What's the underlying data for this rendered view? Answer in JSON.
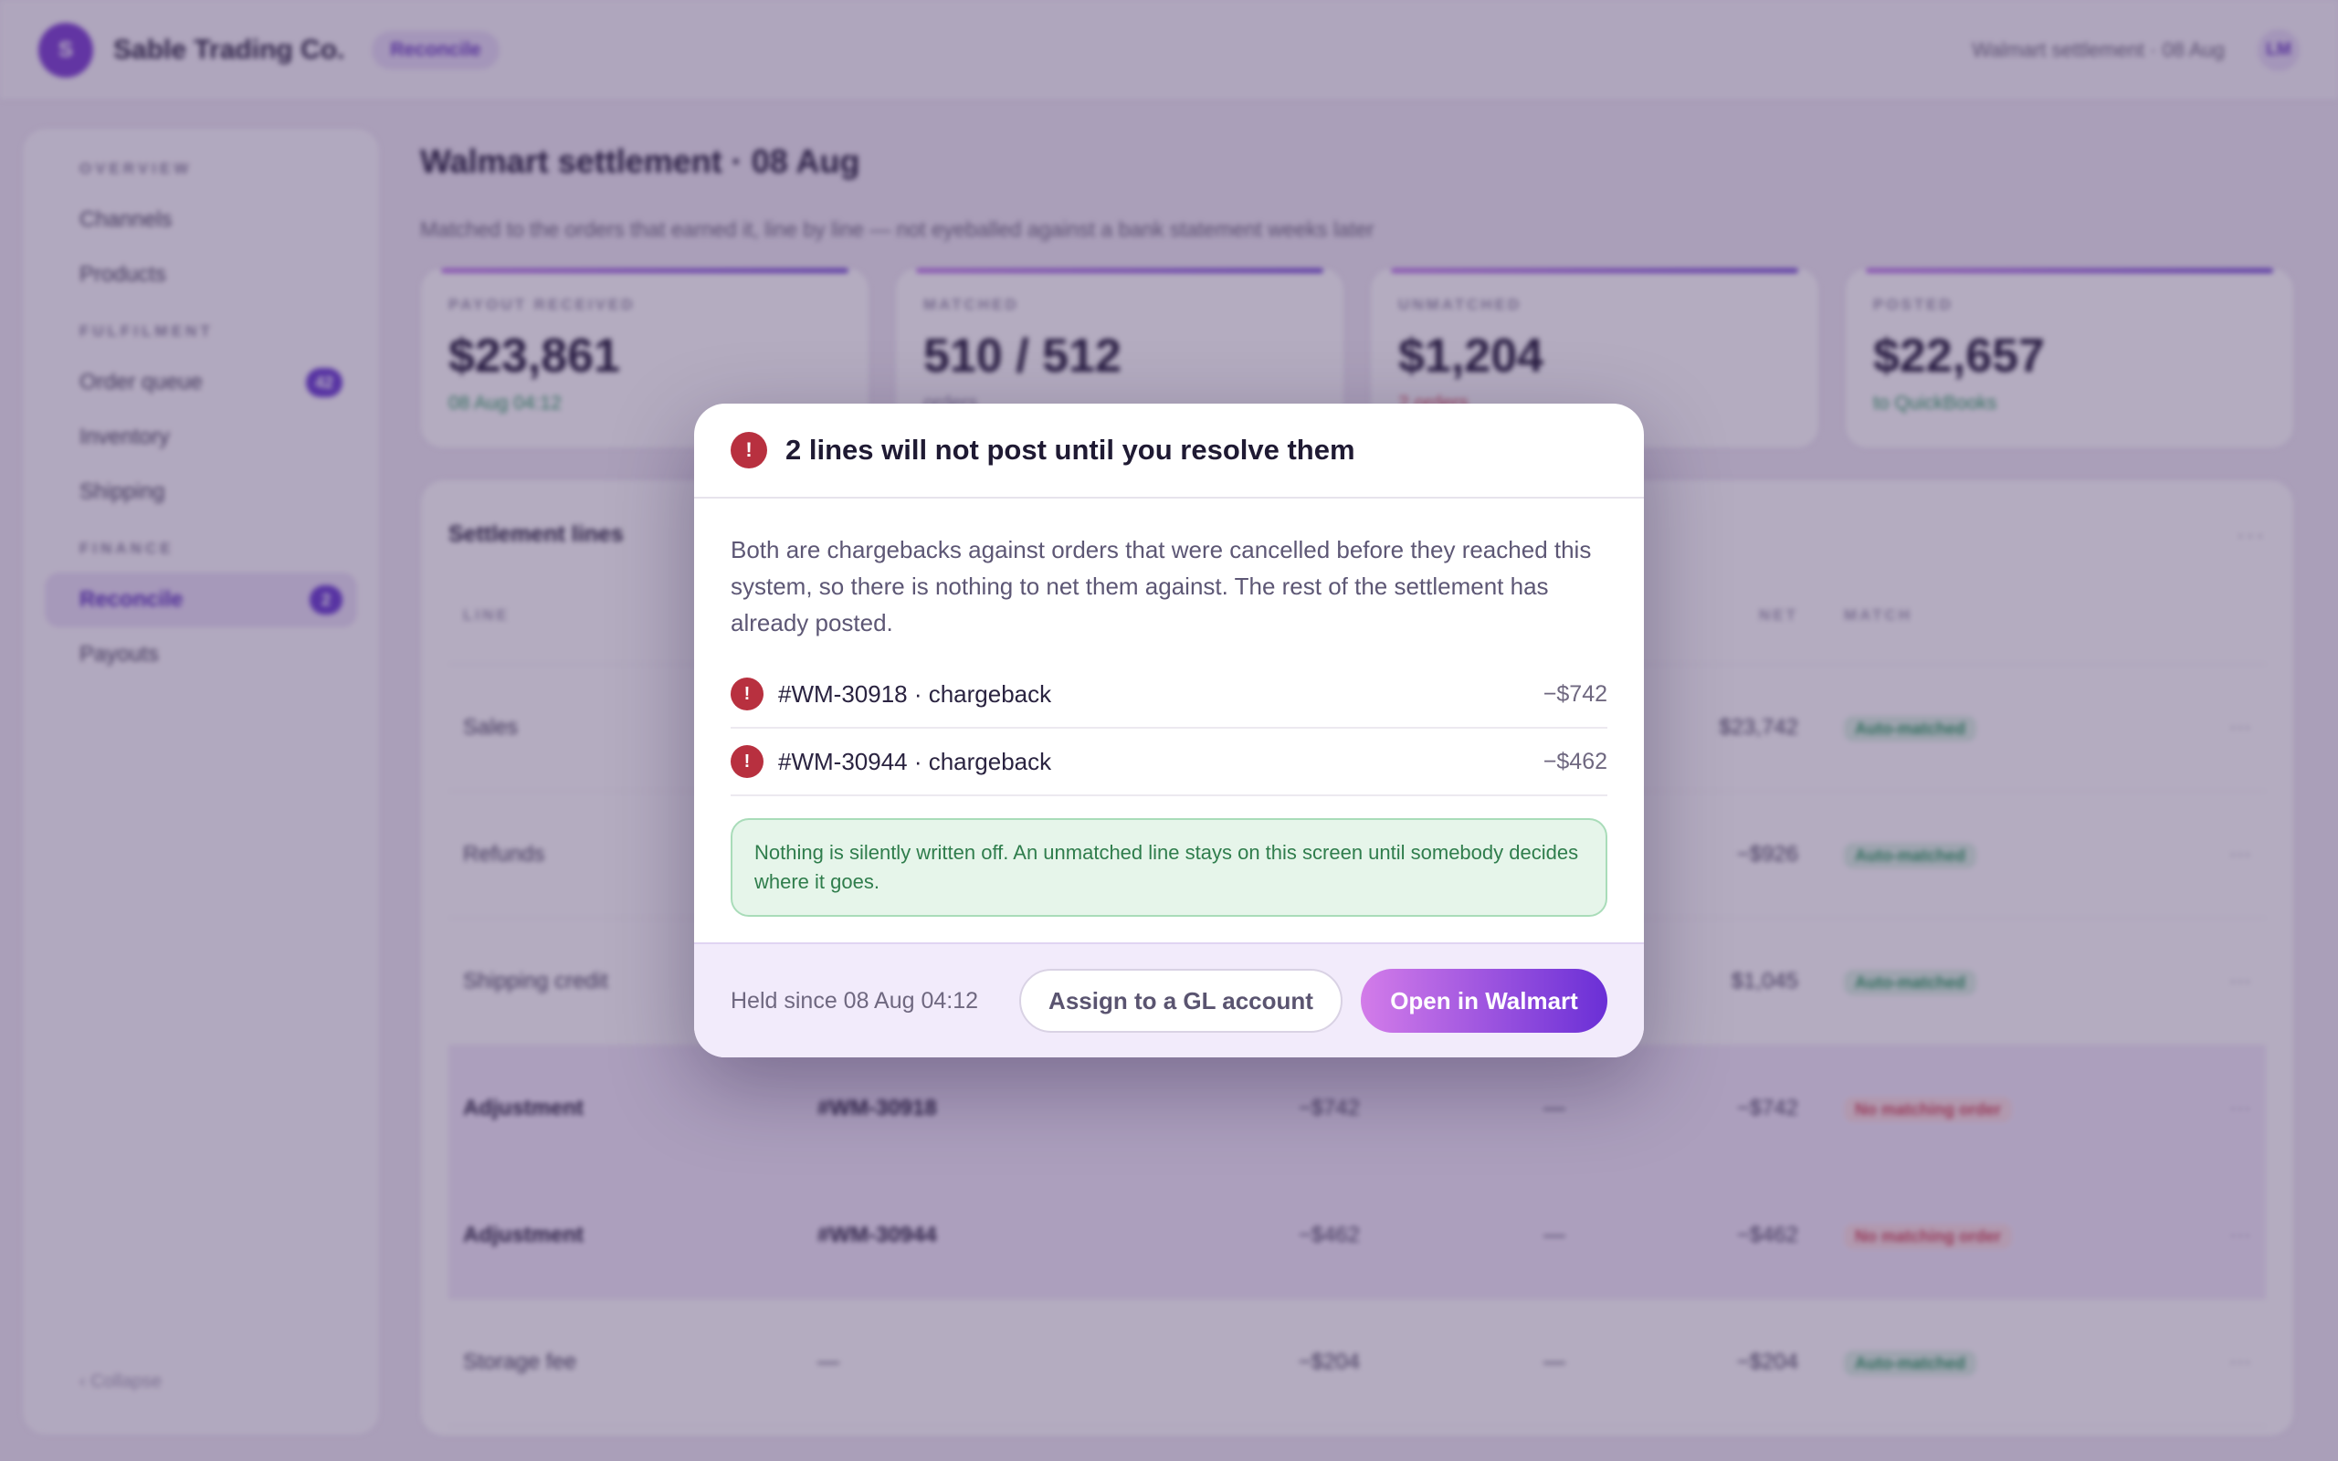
{
  "topbar": {
    "logo_letter": "S",
    "brand": "Sable Trading Co.",
    "section_tag": "Reconcile",
    "breadcrumb": "Walmart settlement · 08 Aug",
    "user_initials": "LM"
  },
  "sidebar": {
    "groups": [
      {
        "label": "OVERVIEW",
        "items": [
          {
            "label": "Channels"
          },
          {
            "label": "Products"
          }
        ]
      },
      {
        "label": "FULFILMENT",
        "items": [
          {
            "label": "Order queue",
            "badge": "42"
          },
          {
            "label": "Inventory"
          },
          {
            "label": "Shipping"
          }
        ]
      },
      {
        "label": "FINANCE",
        "items": [
          {
            "label": "Reconcile",
            "badge": "2",
            "active": true
          },
          {
            "label": "Payouts"
          }
        ]
      }
    ],
    "collapse_label": "‹ Collapse"
  },
  "main": {
    "title": "Walmart settlement · 08 Aug",
    "subtitle": "Matched to the orders that earned it, line by line — not eyeballed against a bank statement weeks later"
  },
  "stats": [
    {
      "label": "PAYOUT RECEIVED",
      "value": "$23,861",
      "note": "08 Aug 04:12"
    },
    {
      "label": "MATCHED",
      "value": "510 / 512",
      "note": "orders"
    },
    {
      "label": "UNMATCHED",
      "value": "$1,204",
      "note": "2 orders"
    },
    {
      "label": "POSTED",
      "value": "$22,657",
      "note": "to QuickBooks"
    }
  ],
  "settlement": {
    "title": "Settlement lines",
    "columns": {
      "line": "LINE",
      "net": "NET",
      "match": "MATCH"
    },
    "rows": [
      {
        "line": "Sales",
        "order": "",
        "amount": "",
        "fee": "",
        "net": "$23,742",
        "match": "Auto-matched"
      },
      {
        "line": "Refunds",
        "order": "",
        "amount": "",
        "fee": "",
        "net": "−$926",
        "match": "Auto-matched"
      },
      {
        "line": "Shipping credit",
        "order": "",
        "amount": "",
        "fee": "",
        "net": "$1,045",
        "match": "Auto-matched"
      },
      {
        "line": "Adjustment",
        "order": "#WM-30918",
        "amount": "−$742",
        "fee": "—",
        "net": "−$742",
        "match": "No matching order"
      },
      {
        "line": "Adjustment",
        "order": "#WM-30944",
        "amount": "−$462",
        "fee": "—",
        "net": "−$462",
        "match": "No matching order"
      },
      {
        "line": "Storage fee",
        "order": "—",
        "amount": "−$204",
        "fee": "—",
        "net": "−$204",
        "match": "Auto-matched"
      }
    ]
  },
  "modal": {
    "icon": "!",
    "title": "2 lines will not post until you resolve them",
    "description": "Both are chargebacks against orders that were cancelled before they reached this system, so there is nothing to net them against. The rest of the settlement has already posted.",
    "issues": [
      {
        "label": "#WM-30918 · chargeback",
        "amount": "−$742"
      },
      {
        "label": "#WM-30944 · chargeback",
        "amount": "−$462"
      }
    ],
    "note": "Nothing is silently written off. An unmatched line stays on this screen until somebody decides where it goes.",
    "held_since": "Held since 08 Aug 04:12",
    "secondary_button": "Assign to a GL account",
    "primary_button": "Open in Walmart"
  }
}
